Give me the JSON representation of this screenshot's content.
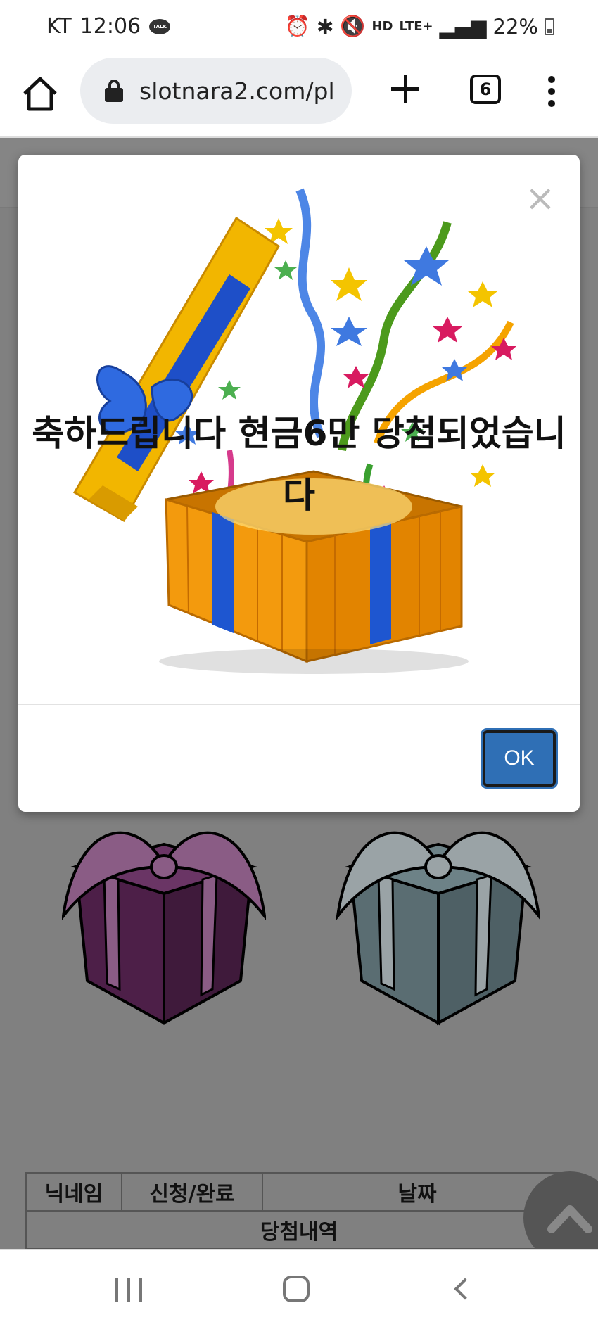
{
  "status_bar": {
    "carrier": "KT",
    "time": "12:06",
    "talk_badge": "TALK",
    "network": "LTE+",
    "hd": "HD",
    "battery": "22%"
  },
  "browser": {
    "url": "slotnara2.com/pl",
    "tab_count": "6"
  },
  "modal": {
    "message": "축하드립니다 현금6만 당첨되었습니다",
    "ok_label": "OK",
    "close_glyph": "×"
  },
  "table": {
    "headers": [
      "닉네임",
      "신청/완료",
      "날짜"
    ],
    "section_title": "당첨내역"
  },
  "colors": {
    "ok_button": "#2f6fb5",
    "overlay": "#808080",
    "gift_purple": "#4d1f48",
    "gift_teal": "#5a6d72"
  }
}
